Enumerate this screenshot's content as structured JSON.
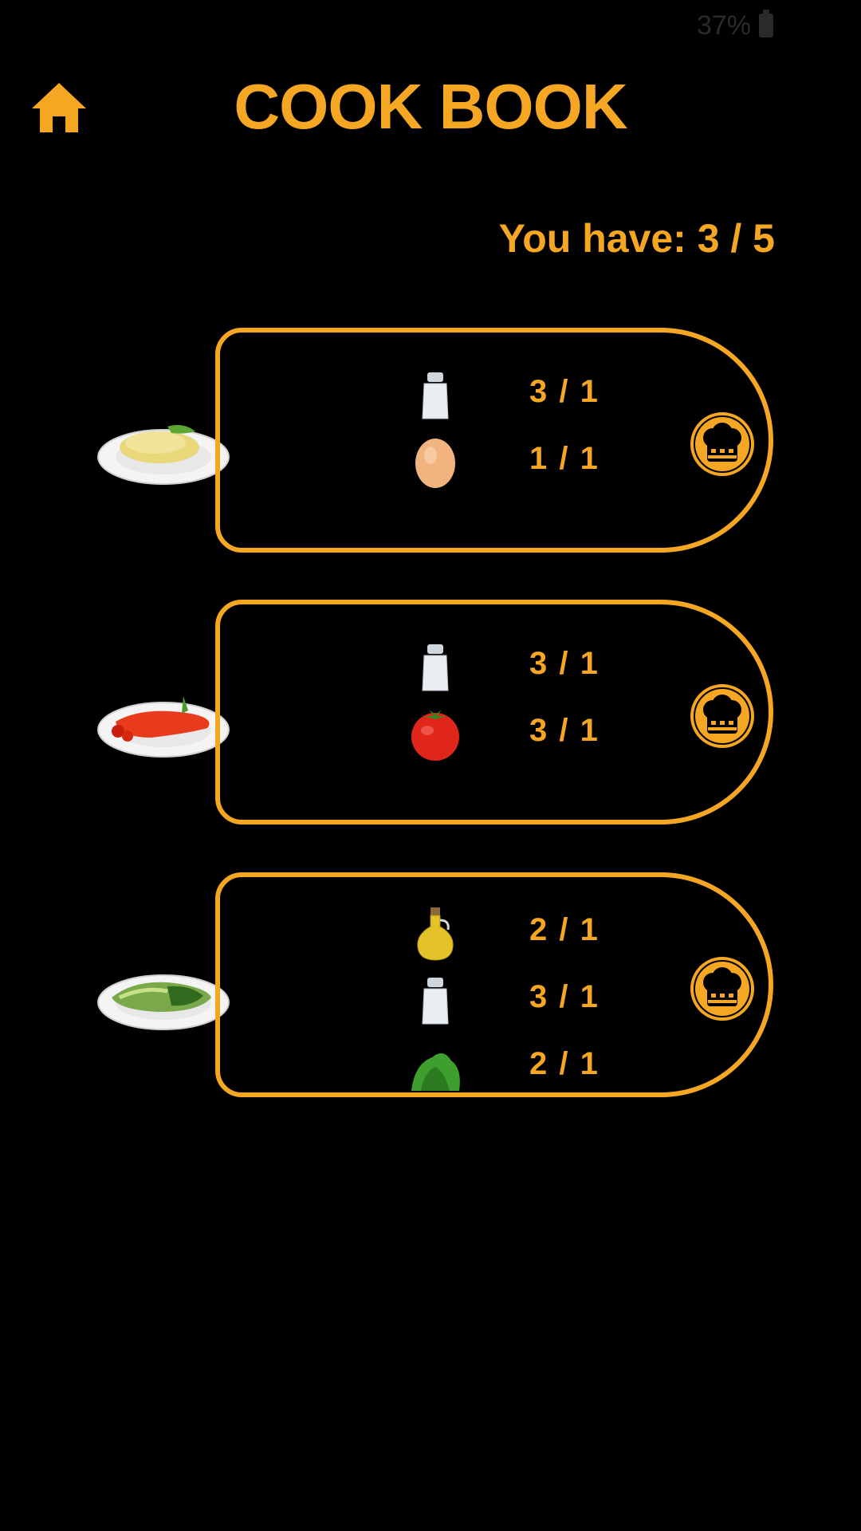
{
  "status_bar": {
    "battery": "37%"
  },
  "header": {
    "title": "COOK BOOK"
  },
  "summary": {
    "you_have": "You have: 3 / 5"
  },
  "recipes": [
    {
      "dish": "omelette-plate",
      "ingredients": [
        {
          "icon": "salt-shaker-icon",
          "amount": "3 / 1"
        },
        {
          "icon": "egg-icon",
          "amount": "1 / 1"
        }
      ]
    },
    {
      "dish": "tomato-dish-plate",
      "ingredients": [
        {
          "icon": "salt-shaker-icon",
          "amount": "3 / 1"
        },
        {
          "icon": "tomato-icon",
          "amount": "3 / 1"
        }
      ]
    },
    {
      "dish": "salad-plate",
      "ingredients": [
        {
          "icon": "oil-bottle-icon",
          "amount": "2 / 1"
        },
        {
          "icon": "salt-shaker-icon",
          "amount": "3 / 1"
        },
        {
          "icon": "lettuce-icon",
          "amount": "2 / 1"
        }
      ]
    }
  ],
  "colors": {
    "accent": "#F5A623",
    "background": "#000000"
  }
}
